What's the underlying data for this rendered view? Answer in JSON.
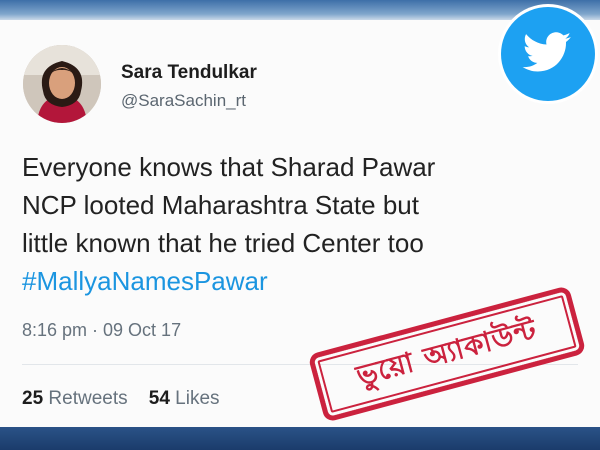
{
  "tweet": {
    "display_name": "Sara Tendulkar",
    "handle": "@SaraSachin_rt",
    "text_lines": [
      "Everyone knows that Sharad Pawar",
      "NCP looted Maharashtra State but",
      "little known that he tried Center too"
    ],
    "hashtag": "#MallyaNamesPawar",
    "timestamp": "8:16 pm · 09 Oct 17",
    "retweets_count": "25",
    "retweets_label": "Retweets",
    "likes_count": "54",
    "likes_label": "Likes"
  },
  "stamp": {
    "text": "ভুয়ো অ্যাকাউন্ট"
  },
  "icons": {
    "badge": "twitter-bird-icon",
    "avatar": "profile-photo"
  },
  "colors": {
    "twitter_blue": "#1da1f2",
    "hashtag": "#1b95e0",
    "stamp_red": "#c8102e"
  }
}
